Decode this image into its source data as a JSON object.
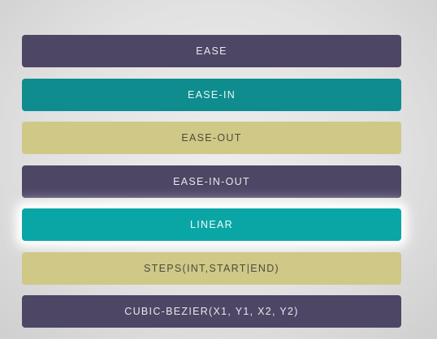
{
  "timing_functions": [
    {
      "label": "EASE",
      "color": "#4e4665"
    },
    {
      "label": "EASE-IN",
      "color": "#0e8c8e"
    },
    {
      "label": "EASE-OUT",
      "color": "#cfc887"
    },
    {
      "label": "EASE-IN-OUT",
      "color": "#4e4665"
    },
    {
      "label": "LINEAR",
      "color": "#0aa6a6",
      "active": true
    },
    {
      "label": "STEPS(INT,START|END)",
      "color": "#cfc887"
    },
    {
      "label": "CUBIC-BEZIER(X1, Y1, X2, Y2)",
      "color": "#4e4665"
    }
  ]
}
